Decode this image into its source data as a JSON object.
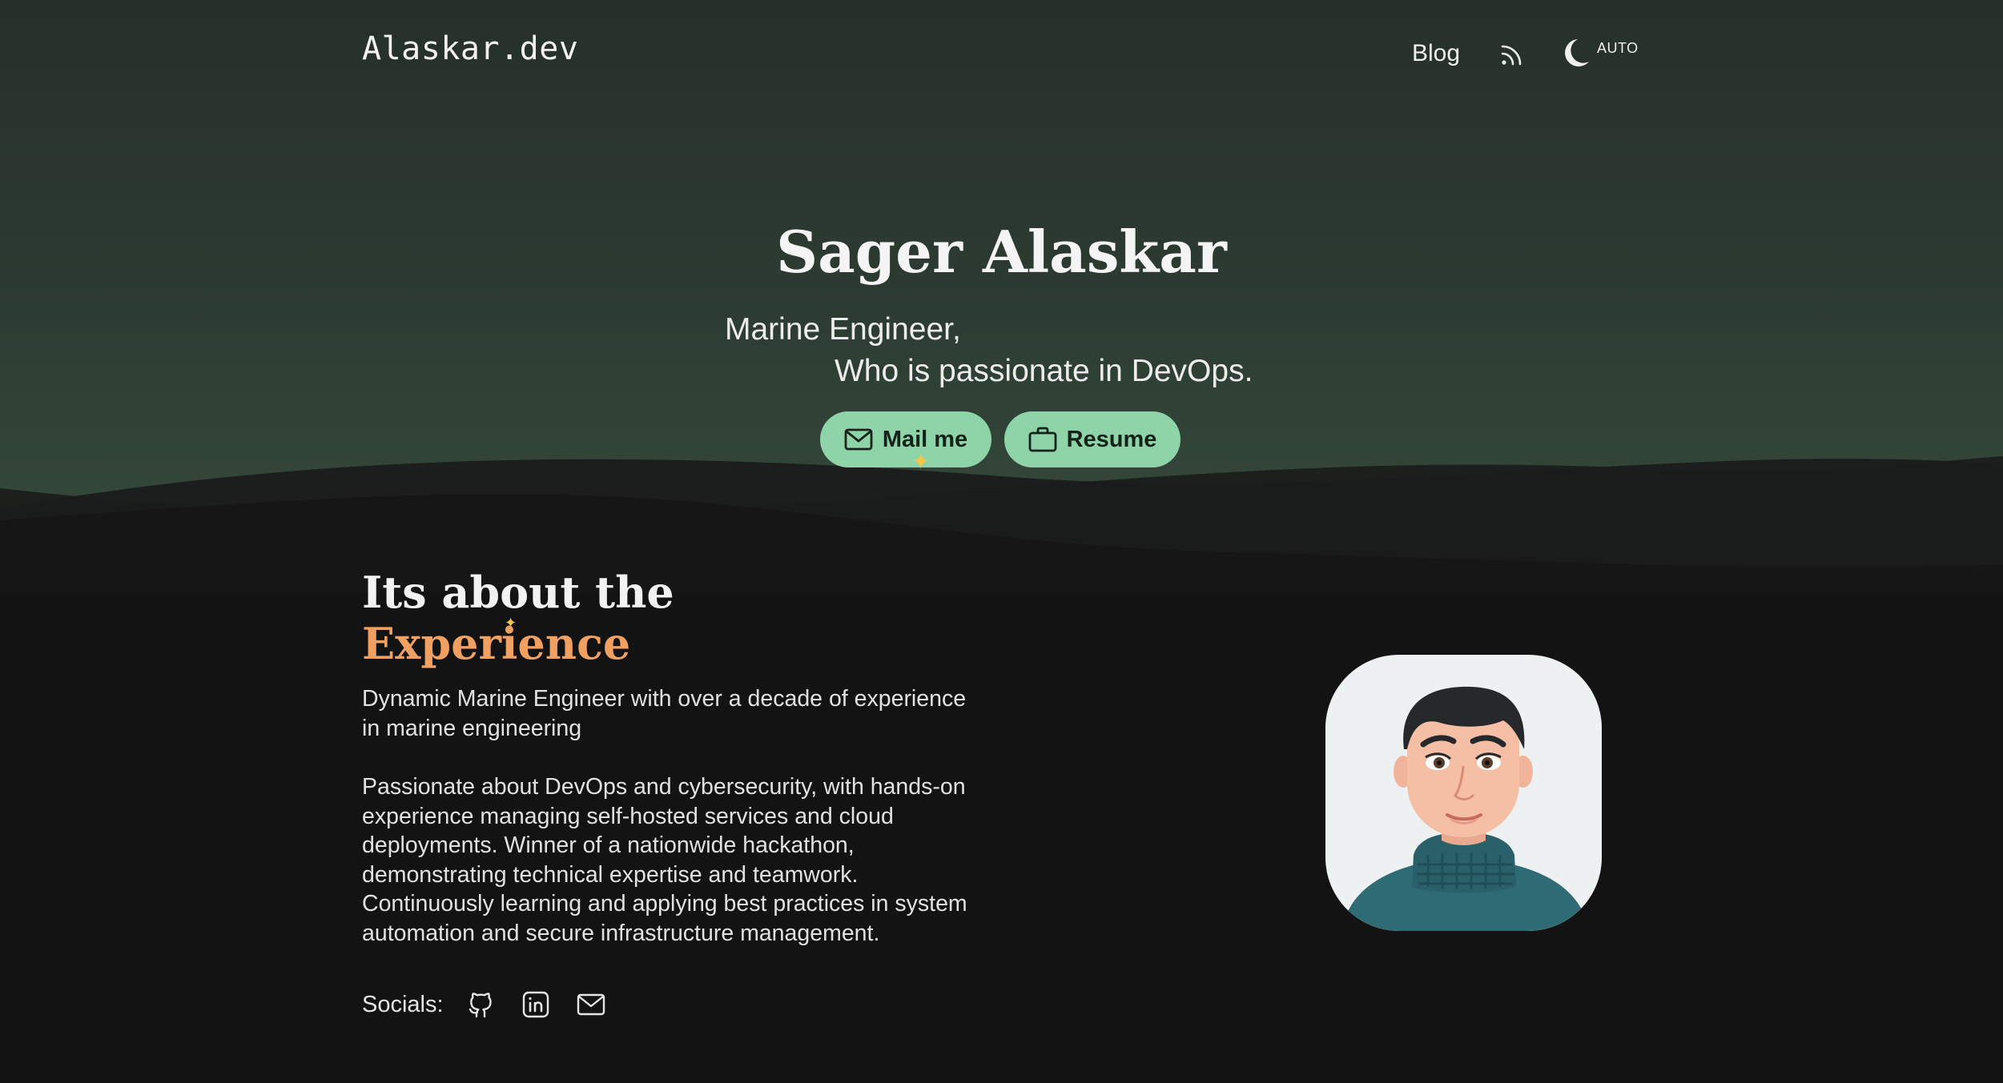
{
  "header": {
    "logo": "Alaskar.dev",
    "nav": {
      "blog_label": "Blog"
    },
    "rss_icon": "rss-icon",
    "theme_toggle": {
      "icon": "moon-icon",
      "label": "AUTO"
    }
  },
  "hero": {
    "title": "Sager Alaskar",
    "tagline_line1": "Marine Engineer,",
    "tagline_line2": "Who is passionate in DevOps.",
    "buttons": {
      "mail_label": "Mail me",
      "mail_icon": "mail-icon",
      "resume_label": "Resume",
      "resume_icon": "briefcase-icon"
    }
  },
  "about": {
    "heading_line1": "Its about the",
    "heading_line2": "Experience",
    "paragraph1": "Dynamic Marine Engineer with over a decade of experience in marine engineering",
    "paragraph2": "Passionate about DevOps and cybersecurity, with hands-on experience managing self-hosted services and cloud deployments. Winner of a nationwide hackathon, demonstrating technical expertise and teamwork. Continuously learning and applying best practices in system automation and secure infrastructure management.",
    "socials_label": "Socials:",
    "social_icons": [
      "github-icon",
      "linkedin-icon",
      "mail-icon"
    ],
    "avatar": "avatar-illustration"
  },
  "colors": {
    "hero_top": "#263029",
    "hero_bottom": "#34493b",
    "page_bg": "#131313",
    "button_bg": "#8fd3a8",
    "accent_orange": "#f0a060",
    "sparkle": "#f3c84a"
  }
}
